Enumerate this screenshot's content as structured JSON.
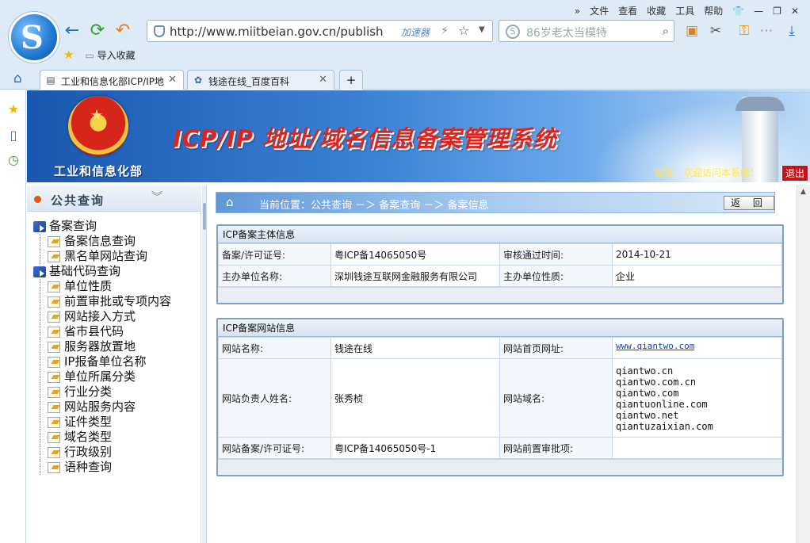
{
  "browser": {
    "menu": [
      "文件",
      "查看",
      "收藏",
      "工具",
      "帮助"
    ],
    "url": "http://www.miitbeian.gov.cn/publish/quer",
    "accelerator": "加速器",
    "search_placeholder": "86岁老太当模特",
    "favorites_import": "导入收藏",
    "tabs": [
      {
        "label": "工业和信息化部ICP/IP地"
      },
      {
        "label": "钱途在线_百度百科"
      }
    ]
  },
  "header": {
    "ministry": "工业和信息化部",
    "title": "ICP/IP 地址/域名信息备案管理系统",
    "welcome": "您好，欢迎访问本系统！",
    "logout": "退出"
  },
  "sidebar": {
    "title": "公共查询",
    "tree": [
      {
        "label": "备案查询",
        "children": [
          "备案信息查询",
          "黑名单网站查询"
        ]
      },
      {
        "label": "基础代码查询",
        "children": [
          "单位性质",
          "前置审批或专项内容",
          "网站接入方式",
          "省市县代码",
          "服务器放置地",
          "IP报备单位名称",
          "单位所属分类",
          "行业分类",
          "网站服务内容",
          "证件类型",
          "域名类型",
          "行政级别",
          "语种查询"
        ]
      }
    ]
  },
  "breadcrumb": {
    "text": "当前位置：公共查询  －＞  备案查询  －＞  备案信息",
    "back": "返 回"
  },
  "subject": {
    "title": "ICP备案主体信息",
    "license_label": "备案/许可证号:",
    "license": "粤ICP备14065050号",
    "approval_label": "审核通过时间:",
    "approval": "2014-10-21",
    "org_label": "主办单位名称:",
    "org": "深圳钱途互联网金融服务有限公司",
    "nature_label": "主办单位性质:",
    "nature": "企业"
  },
  "website": {
    "title": "ICP备案网站信息",
    "name_label": "网站名称:",
    "name": "钱途在线",
    "home_label": "网站首页网址:",
    "home": "www.qiantwo.com",
    "owner_label": "网站负责人姓名:",
    "owner": "张秀桢",
    "domain_label": "网站域名:",
    "domains": [
      "qiantwo.cn",
      "qiantwo.com.cn",
      "qiantwo.com",
      "qiantuonline.com",
      "qiantwo.net",
      "qiantuzaixian.com"
    ],
    "license_label": "网站备案/许可证号:",
    "license": "粤ICP备14065050号-1",
    "preapproval_label": "网站前置审批项:",
    "preapproval": ""
  }
}
